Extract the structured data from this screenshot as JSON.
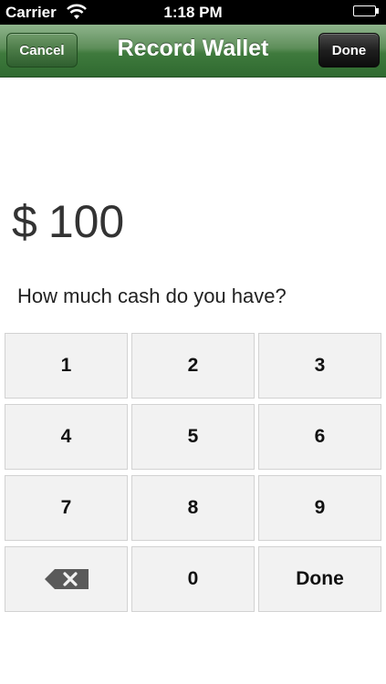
{
  "status_bar": {
    "carrier": "Carrier",
    "time": "1:18 PM"
  },
  "nav": {
    "title": "Record Wallet",
    "cancel_label": "Cancel",
    "done_label": "Done"
  },
  "amount": {
    "currency": "$",
    "value": "100"
  },
  "prompt": "How much cash do you have?",
  "keypad": {
    "keys": [
      "1",
      "2",
      "3",
      "4",
      "5",
      "6",
      "7",
      "8",
      "9",
      "",
      "0",
      "Done"
    ],
    "backspace_icon": "backspace-icon"
  },
  "colors": {
    "nav_green": "#3f7a3d",
    "key_background": "#f2f2f2"
  }
}
